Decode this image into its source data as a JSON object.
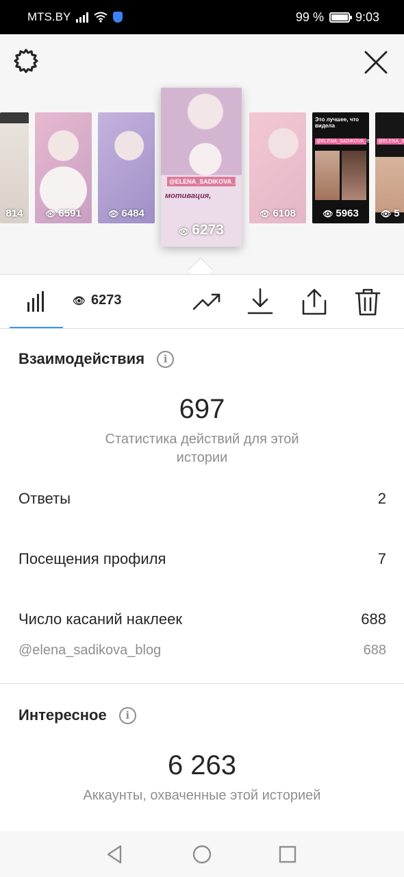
{
  "status_bar": {
    "carrier": "MTS.BY",
    "battery": "99 %",
    "time": "9:03"
  },
  "stories": [
    {
      "views": "814",
      "bg": "#e9e2dc"
    },
    {
      "views": "6591",
      "bg": "#e8c8d6"
    },
    {
      "views": "6484",
      "bg": "#c7b9de"
    },
    {
      "views": "6273",
      "bg": "#ead7e6",
      "featured": true,
      "overlay_tag": "@ELENA_SADIKOVA_BLOG",
      "overlay_title": "мотивация,"
    },
    {
      "views": "6108",
      "bg": "#f0cbd6"
    },
    {
      "views": "5963",
      "bg": "#111111",
      "overlay_title": "Это лучшее, что видела",
      "overlay_tag": "@ELENA_SADIKOVA_BLOG"
    },
    {
      "views": "5",
      "bg": "#161616",
      "overlay_tag": "@ELENA_SADIKOVA_BLOG"
    }
  ],
  "toolbar": {
    "views": "6273"
  },
  "interactions": {
    "title": "Взаимодействия",
    "total": "697",
    "subtitle": "Статистика действий для этой истории",
    "rows": [
      {
        "label": "Ответы",
        "value": "2"
      },
      {
        "label": "Посещения профиля",
        "value": "7"
      },
      {
        "label": "Число касаний наклеек",
        "value": "688"
      }
    ],
    "sticker_row": {
      "label": "@elena_sadikova_blog",
      "value": "688"
    }
  },
  "discovery": {
    "title": "Интересное",
    "total": "6 263",
    "subtitle": "Аккаунты, охваченные этой историей"
  },
  "colors": {
    "accent": "#3897f0",
    "text": "#262626",
    "secondary": "#8e8e8e",
    "divider": "#dbdbdb"
  }
}
